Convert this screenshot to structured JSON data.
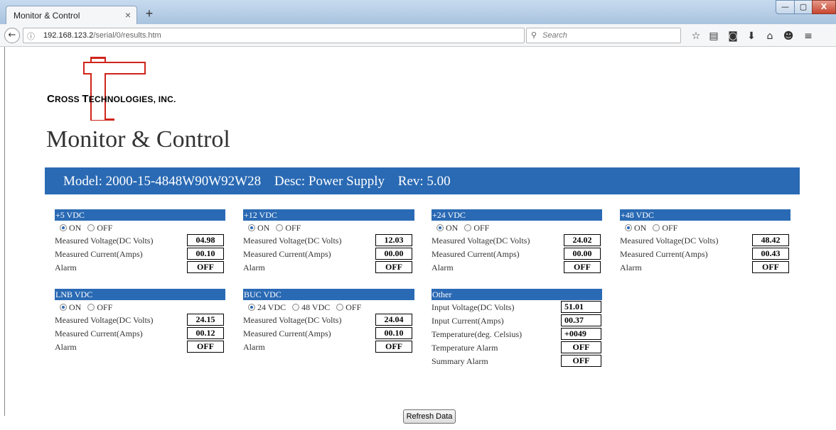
{
  "browser": {
    "tab_title": "Monitor & Control",
    "tab_close": "×",
    "new_tab": "+",
    "url_host": "192.168.123.2",
    "url_path": "/serial/0/results.htm",
    "search_placeholder": "Search",
    "window_buttons": {
      "minimize": "—",
      "maximize": "▢",
      "close": "X"
    },
    "icons": [
      "star-icon",
      "reading-list-icon",
      "pocket-icon",
      "download-icon",
      "home-icon",
      "chat-icon",
      "menu-icon"
    ]
  },
  "company": {
    "logo_text_first": "C",
    "logo_text_rest_1": "ROSS ",
    "logo_text_first_2": "T",
    "logo_text_rest_2": "ECHNOLOGIES, INC."
  },
  "page_title": "Monitor & Control",
  "header": {
    "model_label": "Model:",
    "model_value": "2000-15-4848W90W92W28",
    "desc_label": "Desc:",
    "desc_value": "Power Supply",
    "rev_label": "Rev:",
    "rev_value": "5.00"
  },
  "panels": {
    "p5": {
      "title": "+5 VDC",
      "opt_on": "ON",
      "opt_off": "OFF",
      "voltage_label": "Measured Voltage(DC Volts)",
      "voltage": "04.98",
      "current_label": "Measured Current(Amps)",
      "current": "00.10",
      "alarm_label": "Alarm",
      "alarm": "OFF"
    },
    "p12": {
      "title": "+12 VDC",
      "opt_on": "ON",
      "opt_off": "OFF",
      "voltage_label": "Measured Voltage(DC Volts)",
      "voltage": "12.03",
      "current_label": "Measured Current(Amps)",
      "current": "00.00",
      "alarm_label": "Alarm",
      "alarm": "OFF"
    },
    "p24": {
      "title": "+24 VDC",
      "opt_on": "ON",
      "opt_off": "OFF",
      "voltage_label": "Measured Voltage(DC Volts)",
      "voltage": "24.02",
      "current_label": "Measured Current(Amps)",
      "current": "00.00",
      "alarm_label": "Alarm",
      "alarm": "OFF"
    },
    "p48": {
      "title": "+48 VDC",
      "opt_on": "ON",
      "opt_off": "OFF",
      "voltage_label": "Measured Voltage(DC Volts)",
      "voltage": "48.42",
      "current_label": "Measured Current(Amps)",
      "current": "00.43",
      "alarm_label": "Alarm",
      "alarm": "OFF"
    },
    "lnb": {
      "title": "LNB VDC",
      "opt_on": "ON",
      "opt_off": "OFF",
      "voltage_label": "Measured Voltage(DC Volts)",
      "voltage": "24.15",
      "current_label": "Measured Current(Amps)",
      "current": "00.12",
      "alarm_label": "Alarm",
      "alarm": "OFF"
    },
    "buc": {
      "title": "BUC VDC",
      "opt_24": "24 VDC",
      "opt_48": "48 VDC",
      "opt_off": "OFF",
      "voltage_label": "Measured Voltage(DC Volts)",
      "voltage": "24.04",
      "current_label": "Measured Current(Amps)",
      "current": "00.10",
      "alarm_label": "Alarm",
      "alarm": "OFF"
    },
    "other": {
      "title": "Other",
      "input_voltage_label": "Input Voltage(DC Volts)",
      "input_voltage": "51.01",
      "input_current_label": "Input Current(Amps)",
      "input_current": "00.37",
      "temperature_label": "Temperature(deg. Celsius)",
      "temperature": "+0049",
      "temp_alarm_label": "Temperature Alarm",
      "temp_alarm": "OFF",
      "summary_alarm_label": "Summary Alarm",
      "summary_alarm": "OFF"
    }
  },
  "refresh_label": "Refresh Data",
  "colors": {
    "accent": "#2a6ab4",
    "logo_red": "#d0241b"
  }
}
